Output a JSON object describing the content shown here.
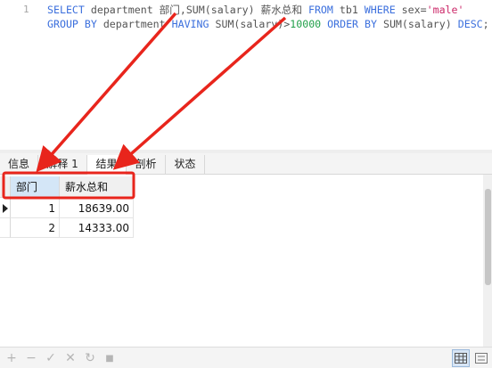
{
  "editor": {
    "line_number": "1",
    "line1": [
      {
        "t": "SELECT",
        "c": "kw"
      },
      {
        "t": " department 部门,",
        "c": "txt"
      },
      {
        "t": "SUM",
        "c": "txt"
      },
      {
        "t": "(salary) 薪水总和 ",
        "c": "txt"
      },
      {
        "t": "FROM",
        "c": "kw"
      },
      {
        "t": " tb1 ",
        "c": "txt"
      },
      {
        "t": "WHERE",
        "c": "kw"
      },
      {
        "t": " sex=",
        "c": "txt"
      },
      {
        "t": "'male'",
        "c": "str"
      }
    ],
    "line2": [
      {
        "t": "GROUP BY",
        "c": "kw"
      },
      {
        "t": " department ",
        "c": "txt"
      },
      {
        "t": "HAVING",
        "c": "kw"
      },
      {
        "t": " SUM(salary)>",
        "c": "txt"
      },
      {
        "t": "10000",
        "c": "num"
      },
      {
        "t": " ",
        "c": "txt"
      },
      {
        "t": "ORDER BY",
        "c": "kw"
      },
      {
        "t": " SUM(salary) ",
        "c": "txt"
      },
      {
        "t": "DESC",
        "c": "kw"
      },
      {
        "t": ";",
        "c": "txt"
      }
    ]
  },
  "tabs": [
    {
      "label": "信息",
      "active": false
    },
    {
      "label": "解释 1",
      "active": false
    },
    {
      "label": "结果",
      "active": true
    },
    {
      "label": "剖析",
      "active": false
    },
    {
      "label": "状态",
      "active": false
    }
  ],
  "grid": {
    "columns": [
      "部门",
      "薪水总和"
    ],
    "rows": [
      [
        "1",
        "18639.00"
      ],
      [
        "2",
        "14333.00"
      ]
    ],
    "current_row": 0
  },
  "bottom_toolbar": {
    "buttons": [
      {
        "name": "add-record-icon",
        "glyph": "+"
      },
      {
        "name": "delete-record-icon",
        "glyph": "−"
      },
      {
        "name": "apply-changes-icon",
        "glyph": "✓"
      },
      {
        "name": "discard-changes-icon",
        "glyph": "✕"
      },
      {
        "name": "refresh-icon",
        "glyph": "↻"
      },
      {
        "name": "stop-icon",
        "glyph": "■"
      }
    ],
    "view_buttons": [
      {
        "name": "grid-view-icon",
        "active": true
      },
      {
        "name": "form-view-icon",
        "active": false
      }
    ]
  },
  "colors": {
    "keyword": "#3b6fdd",
    "string": "#cc2a6a",
    "number": "#22a04a",
    "annotation": "#e8251c"
  }
}
